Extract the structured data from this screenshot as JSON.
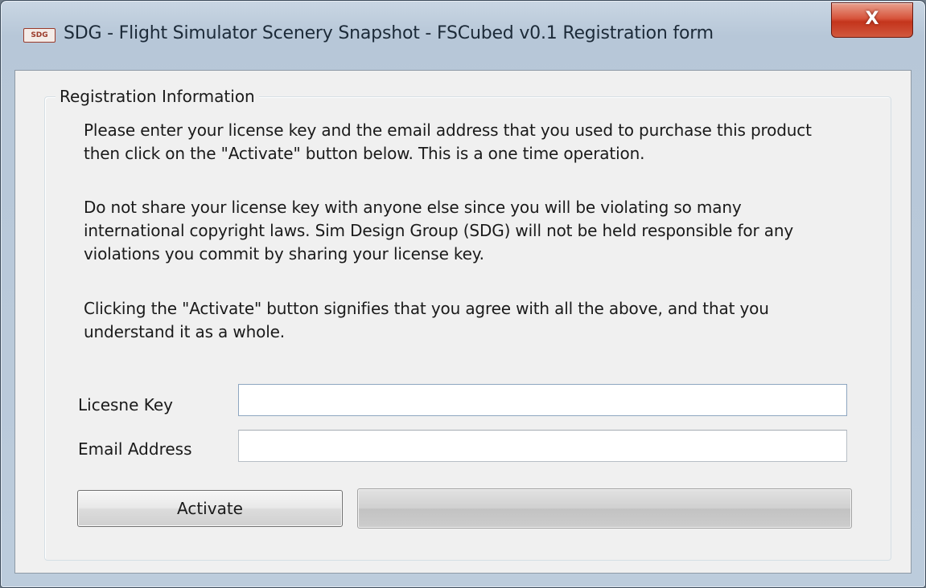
{
  "window": {
    "title": "SDG - Flight Simulator Scenery Snapshot - FSCubed v0.1 Registration form",
    "icon_text": "SDG",
    "close_glyph": "X"
  },
  "group": {
    "label": "Registration Information"
  },
  "paragraphs": [
    "Please enter your license key and the email address that you used to purchase this product then click on the \"Activate\" button below. This is a one time operation.",
    "Do not share your license key with anyone else since you will be violating so many international copyright laws. Sim Design Group (SDG) will not be held responsible for any violations you commit by sharing your license key.",
    "Clicking the \"Activate\" button signifies that you agree with all the above, and that you understand it as a whole."
  ],
  "form": {
    "license_key_label": "Licesne Key",
    "license_key_value": "",
    "email_label": "Email Address",
    "email_value": ""
  },
  "actions": {
    "activate_label": "Activate"
  },
  "progress": {
    "value": 0
  },
  "icons": {
    "app": "sdg-app-icon",
    "close": "close-icon"
  }
}
